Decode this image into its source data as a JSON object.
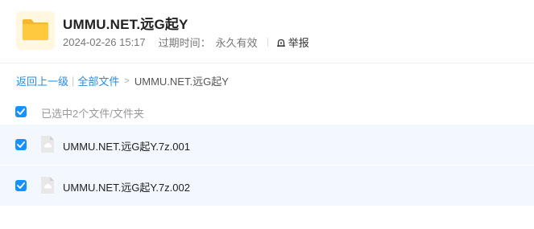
{
  "folder": {
    "name": "UMMU.NET.远G起Y",
    "date": "2024-02-26 15:17",
    "expire_label": "过期时间：",
    "expire_value": "永久有效",
    "report_label": "举报"
  },
  "breadcrumb": {
    "back": "返回上一级",
    "separator": "|",
    "all_files": "全部文件",
    "arrow": ">",
    "current": "UMMU.NET.远G起Y"
  },
  "selection": {
    "text": "已选中2个文件/文件夹"
  },
  "files": [
    {
      "name": "UMMU.NET.远G起Y.7z.001",
      "checked": true
    },
    {
      "name": "UMMU.NET.远G起Y.7z.002",
      "checked": true
    }
  ],
  "colors": {
    "accent": "#1890ff",
    "link": "#2a8bdd",
    "row_bg": "#f3f8fe",
    "folder": "#ffc53d"
  },
  "icons": {
    "folder": "folder-icon",
    "report": "report-icon",
    "checkbox": "checkmark-icon",
    "file": "file-icon"
  }
}
